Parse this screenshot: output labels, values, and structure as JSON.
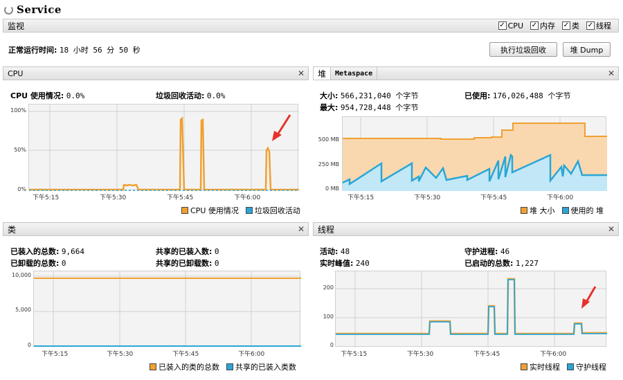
{
  "app": {
    "title": "Service"
  },
  "monitor": {
    "title": "监视",
    "checks": [
      {
        "label": "CPU",
        "checked": true
      },
      {
        "label": "内存",
        "checked": true
      },
      {
        "label": "类",
        "checked": true
      },
      {
        "label": "线程",
        "checked": true
      }
    ],
    "uptime_label": "正常运行时间:",
    "uptime_value": "18 小时 56 分 50 秒",
    "gc_button": "执行垃圾回收",
    "dump_button": "堆 Dump"
  },
  "colors": {
    "orange": "#f0a030",
    "blue": "#2aa6d6",
    "arrow": "#e8302a"
  },
  "cpu": {
    "title": "CPU",
    "usage_label": "CPU 使用情况:",
    "usage_value": "0.0%",
    "gc_label": "垃圾回收活动:",
    "gc_value": "0.0%",
    "legend": [
      "CPU 使用情况",
      "垃圾回收活动"
    ],
    "yticks": [
      "100%",
      "50%",
      "0%"
    ],
    "xticks": [
      "下午5:15",
      "下午5:30",
      "下午5:45",
      "下午6:00"
    ]
  },
  "heap": {
    "tab_active": "堆",
    "tab_other": "Metaspace",
    "size_label": "大小:",
    "size_value": "566,231,040 个字节",
    "used_label": "已使用:",
    "used_value": "176,026,488 个字节",
    "max_label": "最大:",
    "max_value": "954,728,448 个字节",
    "legend": [
      "堆 大小",
      "使用的 堆"
    ],
    "yticks": [
      "500 MB",
      "250 MB",
      "0 MB"
    ],
    "xticks": [
      "下午5:15",
      "下午5:30",
      "下午5:45",
      "下午6:00"
    ]
  },
  "classes": {
    "title": "类",
    "loaded_label": "已装入的总数:",
    "loaded_value": "9,664",
    "unloaded_label": "已卸载的总数:",
    "unloaded_value": "0",
    "shared_loaded_label": "共享的已装入数:",
    "shared_loaded_value": "0",
    "shared_unloaded_label": "共享的已卸载数:",
    "shared_unloaded_value": "0",
    "legend": [
      "已装入的类的总数",
      "共享的已装入类数"
    ],
    "yticks": [
      "10,000",
      "5,000",
      "0"
    ],
    "xticks": [
      "下午5:15",
      "下午5:30",
      "下午5:45",
      "下午6:00"
    ]
  },
  "threads": {
    "title": "线程",
    "live_label": "活动:",
    "live_value": "48",
    "peak_label": "实时峰值:",
    "peak_value": "240",
    "daemon_label": "守护进程:",
    "daemon_value": "46",
    "started_label": "已启动的总数:",
    "started_value": "1,227",
    "legend": [
      "实时线程",
      "守护线程"
    ],
    "yticks": [
      "200",
      "100",
      "0"
    ],
    "xticks": [
      "下午5:15",
      "下午5:30",
      "下午5:45",
      "下午6:00"
    ]
  }
}
